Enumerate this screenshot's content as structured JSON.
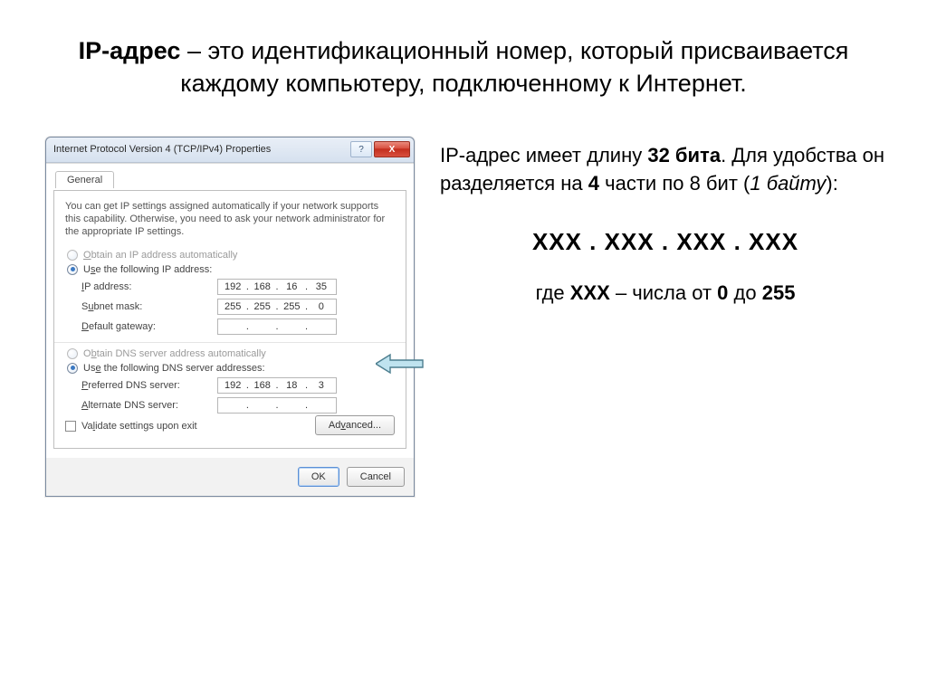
{
  "title": {
    "part1_bold": "IP-адрес",
    "part2": " – это идентификационный номер, который присваивается каждому компьютеру, подключенному к Интернет."
  },
  "dialog": {
    "window_title": "Internet Protocol Version 4 (TCP/IPv4) Properties",
    "help_icon": "?",
    "close_icon": "X",
    "tab": "General",
    "description": "You can get IP settings assigned automatically if your network supports this capability. Otherwise, you need to ask your network administrator for the appropriate IP settings.",
    "radio_auto_ip": "Obtain an IP address automatically",
    "radio_use_ip": "Use the following IP address:",
    "fields": {
      "ip_label": "IP address:",
      "ip_value": [
        "192",
        "168",
        "16",
        "35"
      ],
      "subnet_label": "Subnet mask:",
      "subnet_value": [
        "255",
        "255",
        "255",
        "0"
      ],
      "gateway_label": "Default gateway:",
      "gateway_value": [
        "",
        "",
        "",
        ""
      ]
    },
    "radio_auto_dns": "Obtain DNS server address automatically",
    "radio_use_dns": "Use the following DNS server addresses:",
    "dns": {
      "pref_label": "Preferred DNS server:",
      "pref_value": [
        "192",
        "168",
        "18",
        "3"
      ],
      "alt_label": "Alternate DNS server:",
      "alt_value": [
        "",
        "",
        "",
        ""
      ]
    },
    "validate_label": "Validate settings upon exit",
    "advanced_btn": "Advanced...",
    "ok_btn": "OK",
    "cancel_btn": "Cancel"
  },
  "right": {
    "line1_a": "IP-адрес имеет длину ",
    "line1_bits": "32 бита",
    "line1_b": ". Для удобства он разделяется на ",
    "line1_parts": "4",
    "line1_c": " части по 8 бит (",
    "line1_byte": "1 байту",
    "line1_d": "):",
    "xxx": "ХХХ . ХХХ . ХХХ . ХХХ",
    "where_a": "где ",
    "where_xxx": "ХХХ",
    "where_b": " – числа от ",
    "where_0": "0",
    "where_c": " до ",
    "where_255": "255"
  }
}
